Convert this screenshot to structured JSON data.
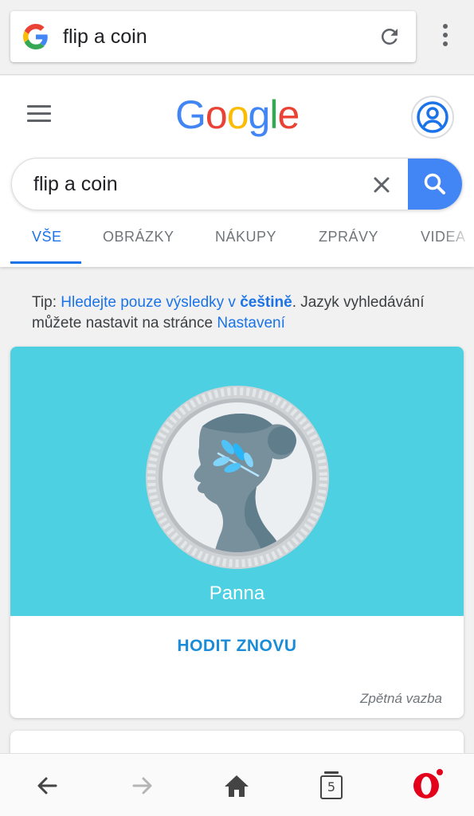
{
  "browser": {
    "url_text": "flip a coin",
    "address_logo_icon": "google-g-icon",
    "reload_icon": "reload-icon",
    "menu_icon": "more-vert-icon"
  },
  "header": {
    "logo_letters": [
      "G",
      "o",
      "o",
      "g",
      "l",
      "e"
    ],
    "logo_colors": [
      "#4285f4",
      "#ea4335",
      "#fbbc05",
      "#4285f4",
      "#34a853",
      "#ea4335"
    ],
    "menu_icon": "hamburger-icon",
    "account_icon": "account-circle-icon"
  },
  "search": {
    "query": "flip a coin",
    "clear_icon": "close-icon",
    "submit_icon": "search-icon"
  },
  "tabs": [
    {
      "label": "VŠE",
      "active": true
    },
    {
      "label": "OBRÁZKY",
      "active": false
    },
    {
      "label": "NÁKUPY",
      "active": false
    },
    {
      "label": "ZPRÁVY",
      "active": false
    },
    {
      "label": "VIDEA",
      "active": false
    }
  ],
  "tip": {
    "prefix": "Tip: ",
    "link_text": "Hledejte pouze výsledky v ",
    "link_bold": "češtině",
    "middle": ". Jazyk vyhledávání můžete nastavit na stránce ",
    "settings_link": "Nastavení"
  },
  "coin_card": {
    "result": "Panna",
    "flip_again": "HODIT ZNOVU",
    "feedback": "Zpětná vazba",
    "bg_color": "#4dd0e1"
  },
  "bottom_nav": {
    "back_icon": "arrow-back-icon",
    "forward_icon": "arrow-forward-icon",
    "home_icon": "home-icon",
    "tabs_count": "5",
    "opera_icon": "opera-logo-icon"
  }
}
